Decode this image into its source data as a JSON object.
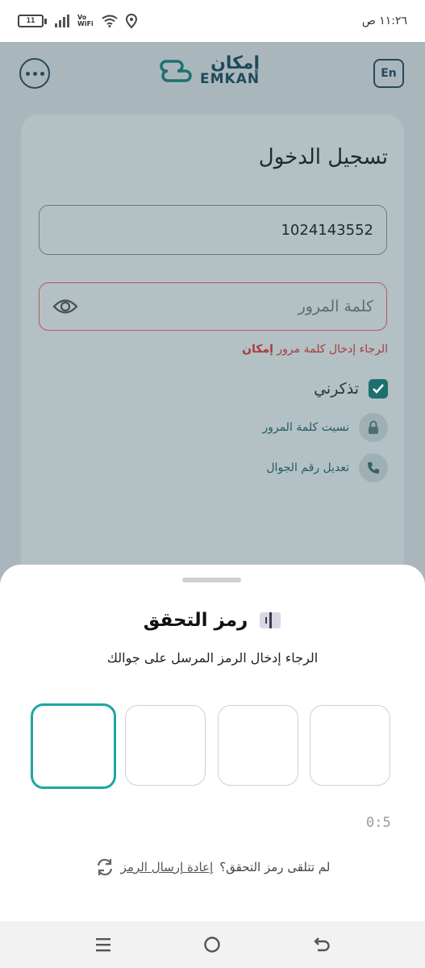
{
  "status_bar": {
    "battery": "11",
    "network": "Vo\nWiFi",
    "time": "١١:٢٦ ص"
  },
  "header": {
    "logo_ar": "إمكان",
    "logo_en": "EMKAN",
    "lang_button": "En"
  },
  "login": {
    "title": "تسجيل الدخول",
    "id_value": "1024143552",
    "password_placeholder": "كلمة المرور",
    "error_prefix": "الرجاء إدخال كلمة مرور",
    "error_brand": "إمكان",
    "remember_label": "تذكرني",
    "forgot_password": "نسيت كلمة المرور",
    "change_mobile": "تعديل رقم الجوال"
  },
  "otp_sheet": {
    "title": "رمز التحقق",
    "subtitle": "الرجاء إدخال الرمز المرسل على جوالك",
    "digits": [
      "",
      "",
      "",
      ""
    ],
    "timer": "0:5",
    "not_received": "لم تتلقى رمز التحقق؟",
    "resend_label": "إعادة إرسال الرمز"
  },
  "colors": {
    "accent": "#1ba7a0",
    "brand_dark": "#1e4a5a",
    "error": "#a83c3c"
  },
  "icons": {
    "more": "more-dots-icon",
    "eye": "eye-icon",
    "lock": "lock-icon",
    "phone": "phone-icon",
    "refresh": "refresh-icon",
    "otp": "otp-card-icon"
  }
}
